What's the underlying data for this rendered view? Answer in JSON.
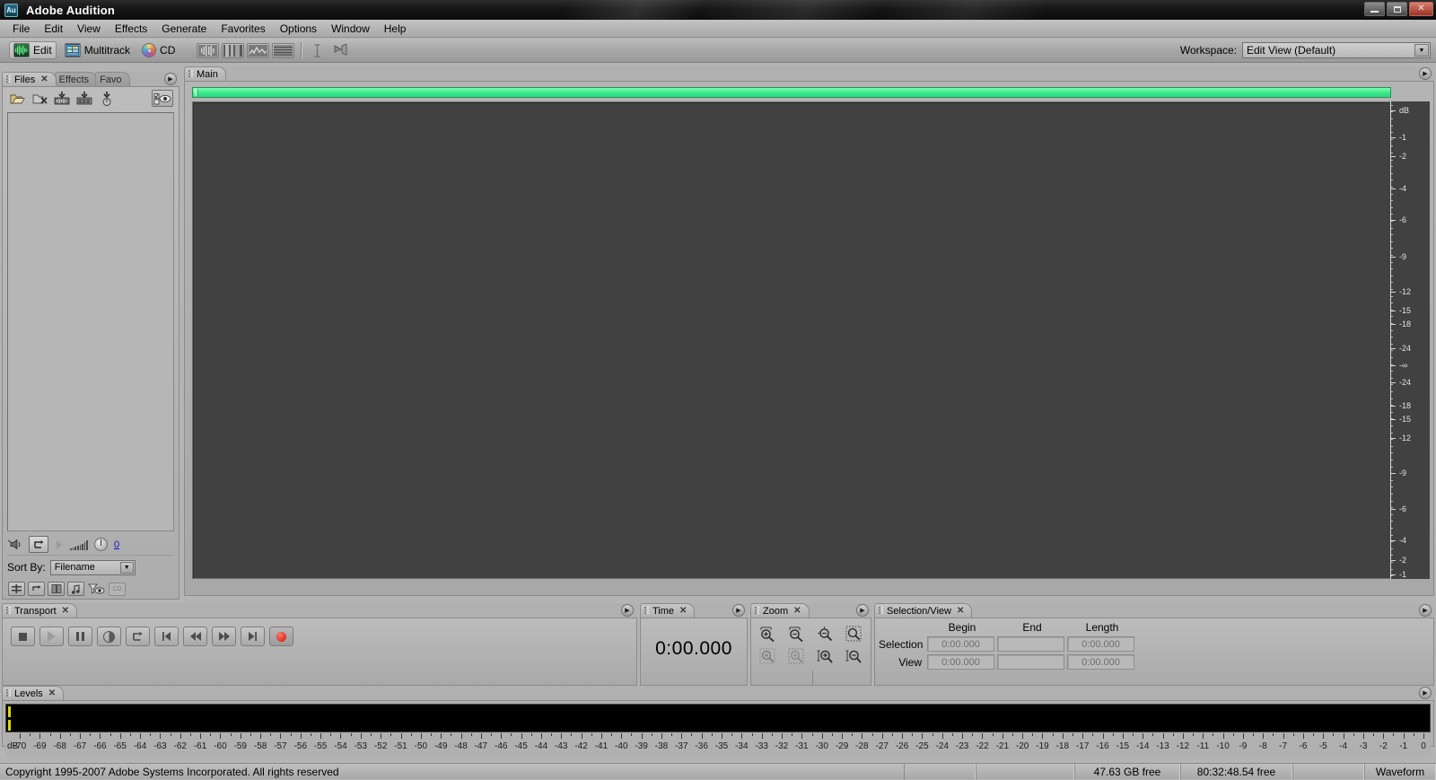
{
  "window": {
    "title": "Adobe Audition",
    "logo_text": "Au",
    "buttons": [
      {
        "name": "minimize-button",
        "label": "—"
      },
      {
        "name": "maximize-button",
        "label": "❐"
      },
      {
        "name": "close-button",
        "label": "✕"
      }
    ]
  },
  "menubar": {
    "items": [
      "File",
      "Edit",
      "View",
      "Effects",
      "Generate",
      "Favorites",
      "Options",
      "Window",
      "Help"
    ]
  },
  "toolbar": {
    "modes": [
      {
        "label": "Edit",
        "icon": "waveform-icon",
        "active": true
      },
      {
        "label": "Multitrack",
        "icon": "multitrack-icon",
        "active": false
      },
      {
        "label": "CD",
        "icon": "cd-disc-icon",
        "active": false
      }
    ],
    "view_buttons": [
      "waveform-view-icon",
      "spectral-frequency-icon",
      "spectral-pan-icon",
      "spectral-phase-icon"
    ],
    "tool_buttons": [
      "time-selection-tool-icon",
      "marquee-selection-tool-icon"
    ],
    "workspace_label": "Workspace:",
    "workspace_value": "Edit View (Default)"
  },
  "files_panel": {
    "tabs": [
      {
        "label": "Files",
        "active": true,
        "closable": true
      },
      {
        "label": "Effects",
        "active": false,
        "closable": false
      },
      {
        "label": "Favo",
        "active": false,
        "closable": false
      }
    ],
    "toolbar_icons": [
      "open-file-icon",
      "close-file-icon",
      "insert-into-multitrack-icon",
      "insert-into-cd-list-icon",
      "insert-into-playlist-icon",
      "show-file-info-icon"
    ],
    "play_icons": [
      "auto-play-icon",
      "loop-play-icon",
      "play-icon",
      "volume-meter-icon",
      "volume-knob-icon"
    ],
    "volume_value": "0",
    "sort_label": "Sort By:",
    "sort_value": "Filename",
    "bottom_icons": [
      "sort-ascending-icon",
      "group-waveforms-icon",
      "show-fullpath-icon",
      "advanced-options-icon",
      "filter-view-icon",
      "batch-icon"
    ]
  },
  "main_panel": {
    "tabs": [
      {
        "label": "Main",
        "active": true,
        "closable": false
      }
    ],
    "db_ruler_unit": "dB",
    "db_ruler_labels": [
      "dB",
      "-1",
      "-2",
      "-4",
      "-6",
      "-9",
      "-12",
      "-15",
      "-18",
      "-24",
      "-∞",
      "-24",
      "-18",
      "-15",
      "-12",
      "-9",
      "-6",
      "-4",
      "-2",
      "-1"
    ]
  },
  "transport": {
    "tabs": [
      {
        "label": "Transport",
        "active": true,
        "closable": true
      }
    ],
    "buttons": [
      {
        "name": "stop-button",
        "icon": "stop-icon"
      },
      {
        "name": "play-button",
        "icon": "play-icon"
      },
      {
        "name": "pause-button",
        "icon": "pause-icon"
      },
      {
        "name": "play-to-end-button",
        "icon": "play-to-end-icon"
      },
      {
        "name": "loop-button",
        "icon": "loop-icon"
      },
      {
        "name": "go-to-beginning-button",
        "icon": "skip-back-icon"
      },
      {
        "name": "rewind-button",
        "icon": "rewind-icon"
      },
      {
        "name": "fast-forward-button",
        "icon": "fast-forward-icon"
      },
      {
        "name": "go-to-end-button",
        "icon": "skip-forward-icon"
      },
      {
        "name": "record-button",
        "icon": "record-icon"
      }
    ]
  },
  "time_panel": {
    "tabs": [
      {
        "label": "Time",
        "active": true,
        "closable": true
      }
    ],
    "value": "0:00.000"
  },
  "zoom_panel": {
    "tabs": [
      {
        "label": "Zoom",
        "active": true,
        "closable": true
      }
    ],
    "buttons": [
      {
        "name": "zoom-in-horizontally-button",
        "icon": "zoom-in-horiz-icon"
      },
      {
        "name": "zoom-out-horizontally-button",
        "icon": "zoom-out-horiz-icon"
      },
      {
        "name": "zoom-out-full-both-axes-button",
        "icon": "zoom-out-full-icon"
      },
      {
        "name": "zoom-to-selection-button",
        "icon": "zoom-selection-icon"
      },
      {
        "name": "zoom-in-left-edge-button",
        "icon": "zoom-left-edge-icon"
      },
      {
        "name": "zoom-in-right-edge-button",
        "icon": "zoom-right-edge-icon"
      },
      {
        "name": "zoom-in-vertically-button",
        "icon": "zoom-in-vert-icon"
      },
      {
        "name": "zoom-out-vertically-button",
        "icon": "zoom-out-vert-icon"
      }
    ]
  },
  "selection_view": {
    "tabs": [
      {
        "label": "Selection/View",
        "active": true,
        "closable": true
      }
    ],
    "columns": [
      "Begin",
      "End",
      "Length"
    ],
    "rows": [
      {
        "label": "Selection",
        "begin": "0:00.000",
        "end": "",
        "length": "0:00.000"
      },
      {
        "label": "View",
        "begin": "0:00.000",
        "end": "",
        "length": "0:00.000"
      }
    ]
  },
  "levels_panel": {
    "tabs": [
      {
        "label": "Levels",
        "active": true,
        "closable": true
      }
    ],
    "unit": "dB",
    "range_min": -70,
    "range_max": 0
  },
  "statusbar": {
    "copyright": "Copyright 1995-2007 Adobe Systems Incorporated. All rights reserved",
    "cell_a": "",
    "cell_b": "",
    "disk_free": "47.63 GB free",
    "time_free": "80:32:48.54 free",
    "cell_c": "",
    "mode": "Waveform"
  },
  "colors": {
    "accent_green": "#37e98b",
    "record_red": "#d01000",
    "wave_bg": "#414141",
    "panel_bg": "#b0b0b0",
    "link_blue": "#1414c8"
  }
}
